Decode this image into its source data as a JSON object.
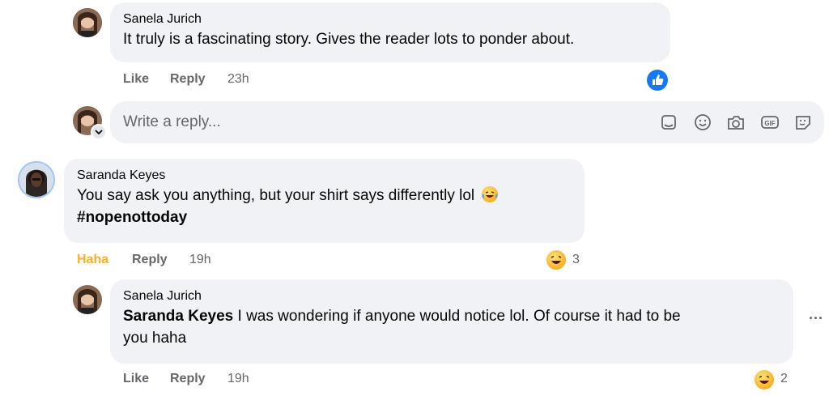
{
  "comments": [
    {
      "author": "Sanela Jurich",
      "text": "It truly is a fascinating story. Gives the reader lots to ponder about.",
      "actions": {
        "like": "Like",
        "reply": "Reply",
        "time": "23h"
      }
    },
    {
      "author": "Saranda Keyes",
      "text_line1": "You say ask you anything, but your shirt says differently lol",
      "hashtag": "#nopenottoday",
      "actions": {
        "like": "Haha",
        "reply": "Reply",
        "time": "19h"
      },
      "reaction_count": "3"
    },
    {
      "author": "Sanela Jurich",
      "mention": "Saranda Keyes",
      "text_line1": " I was wondering if anyone would notice lol. Of course it had to be",
      "text_line2": "you haha",
      "actions": {
        "like": "Like",
        "reply": "Reply",
        "time": "19h"
      },
      "reaction_count": "2",
      "more": "···"
    }
  ],
  "reply_box": {
    "placeholder": "Write a reply...",
    "icons": [
      "sticker-avatar-icon",
      "emoji-icon",
      "camera-icon",
      "gif-icon",
      "sticker-icon"
    ]
  },
  "colors": {
    "bubble": "#f0f2f5",
    "like_blue": "#1877f2",
    "haha_yellow": "#f7b125",
    "meta_gray": "#65676b"
  }
}
